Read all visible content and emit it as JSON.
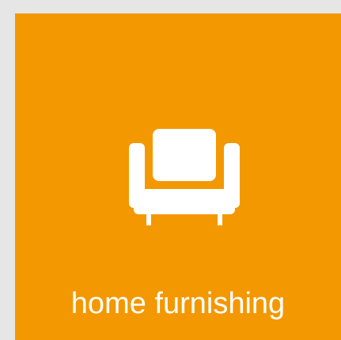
{
  "tile": {
    "label": "home furnishing",
    "icon": "armchair-icon",
    "background_color": "#f39800",
    "foreground_color": "#ffffff"
  },
  "page": {
    "background_color": "#e6e6e6"
  }
}
